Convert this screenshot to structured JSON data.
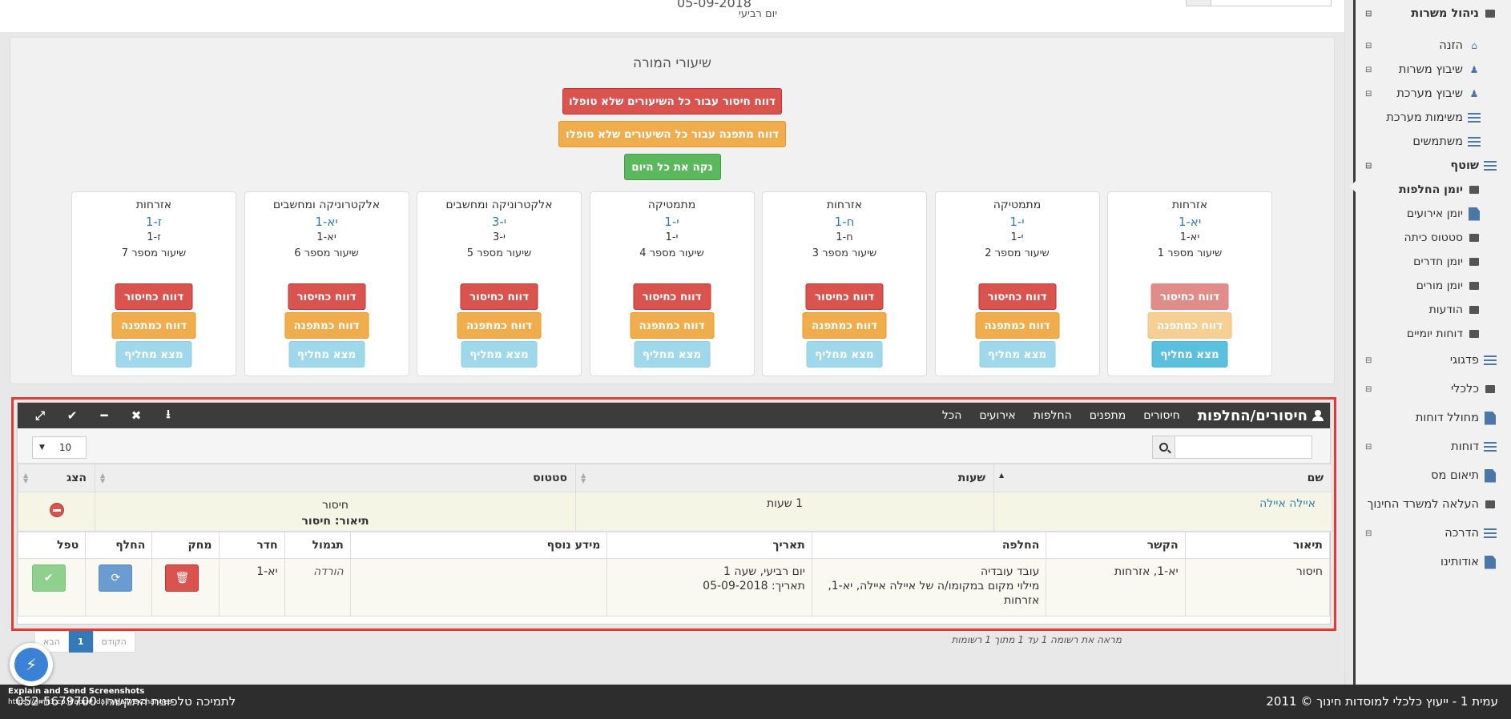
{
  "header": {
    "date": "05-09-2018",
    "day": "יום רביעי"
  },
  "sidebar": {
    "items": [
      {
        "label": "ניהול משרות",
        "level": "top"
      },
      {
        "label": "הזנה",
        "level": "sub"
      },
      {
        "label": "שיבוץ משרות",
        "level": "sub"
      },
      {
        "label": "שיבוץ מערכת",
        "level": "sub"
      },
      {
        "label": "משימות מערכת",
        "level": "sub"
      },
      {
        "label": "משתמשים",
        "level": "sub"
      },
      {
        "label": "שוטף",
        "level": "top"
      },
      {
        "label": "יומן החלפות",
        "level": "sub2"
      },
      {
        "label": "יומן אירועים",
        "level": "sub2"
      },
      {
        "label": "סטטוס כיתה",
        "level": "sub2"
      },
      {
        "label": "יומן חדרים",
        "level": "sub2"
      },
      {
        "label": "יומן מורים",
        "level": "sub2"
      },
      {
        "label": "הודעות",
        "level": "sub2"
      },
      {
        "label": "דוחות יומיים",
        "level": "sub2"
      },
      {
        "label": "פדגוגי",
        "level": "top"
      },
      {
        "label": "כלכלי",
        "level": "top"
      },
      {
        "label": "מחולל דוחות",
        "level": "top"
      },
      {
        "label": "דוחות",
        "level": "top"
      },
      {
        "label": "תיאום מס",
        "level": "top"
      },
      {
        "label": "העלאה למשרד החינוך",
        "level": "top"
      },
      {
        "label": "הדרכה",
        "level": "top"
      },
      {
        "label": "אודותינו",
        "level": "top"
      }
    ]
  },
  "panel": {
    "title": "שיעורי המורה",
    "btn_absence_all": "דווח חיסור עבור כל השיעורים שלא טופלו",
    "btn_pending_all": "דווח מתפנה עבור כל השיעורים שלא טופלו",
    "btn_clear_day": "נקה את כל היום",
    "lessons": [
      {
        "subject": "אזרחות",
        "class": "יא-1",
        "group": "יא-1",
        "number": "שיעור מספר 1"
      },
      {
        "subject": "מתמטיקה",
        "class": "י-1",
        "group": "י-1",
        "number": "שיעור מספר 2"
      },
      {
        "subject": "אזרחות",
        "class": "ח-1",
        "group": "ח-1",
        "number": "שיעור מספר 3"
      },
      {
        "subject": "מתמטיקה",
        "class": "י-1",
        "group": "י-1",
        "number": "שיעור מספר 4"
      },
      {
        "subject": "אלקטרוניקה ומחשבים",
        "class": "י-3",
        "group": "י-3",
        "number": "שיעור מספר 5"
      },
      {
        "subject": "אלקטרוניקה ומחשבים",
        "class": "יא-1",
        "group": "יא-1",
        "number": "שיעור מספר 6"
      },
      {
        "subject": "אזרחות",
        "class": "ז-1",
        "group": "ז-1",
        "number": "שיעור מספר 7"
      }
    ],
    "btn_absence": "דווח כחיסור",
    "btn_pending": "דווח כמתפנה",
    "btn_find": "מצא מחליף"
  },
  "widget": {
    "title": "חיסורים/החלפות",
    "tabs": [
      "חיסורים",
      "מתפנים",
      "החלפות",
      "אירועים",
      "הכל"
    ],
    "page_size": "10",
    "main_table": {
      "headers": [
        "שם",
        "שעות",
        "סטטוס",
        "הצג"
      ],
      "row": {
        "name": "איילה איילה",
        "hours": "1 שעות",
        "status": "חיסור",
        "desc": "תיאור: חיסור"
      }
    },
    "detail_table": {
      "headers": [
        "תיאור",
        "הקשר",
        "החלפה",
        "תאריך",
        "מידע נוסף",
        "תגמול",
        "חדר",
        "מחק",
        "החלף",
        "טפל"
      ],
      "row": {
        "desc": "חיסור",
        "context": "יא-1, אזרחות",
        "replacement_1": "עובד עובדיה",
        "replacement_2": "מילוי מקום במקומו/ה של איילה איילה, יא-1, אזרחות",
        "date_1": "יום רביעי, שעה 1",
        "date_2": "תאריך: 05-09-2018",
        "extra": "",
        "reward": "הורדה",
        "room": "יא-1"
      }
    },
    "info": "מראה את רשומה 1 עד 1 מתוך 1 רשומות",
    "pager": {
      "prev": "הקודם",
      "current": "1",
      "next": "הבא"
    }
  },
  "footer": {
    "right": "עמית 1 - ייעוץ כלכלי למוסדות חינוך   © 2011",
    "left": "לתמיכה טלפונית התקשרו: 052-5679700"
  },
  "overlay": {
    "title": "Explain and Send Screenshots",
    "url": "https://amit1.co.il/app#/daily/dailyexchanges"
  }
}
